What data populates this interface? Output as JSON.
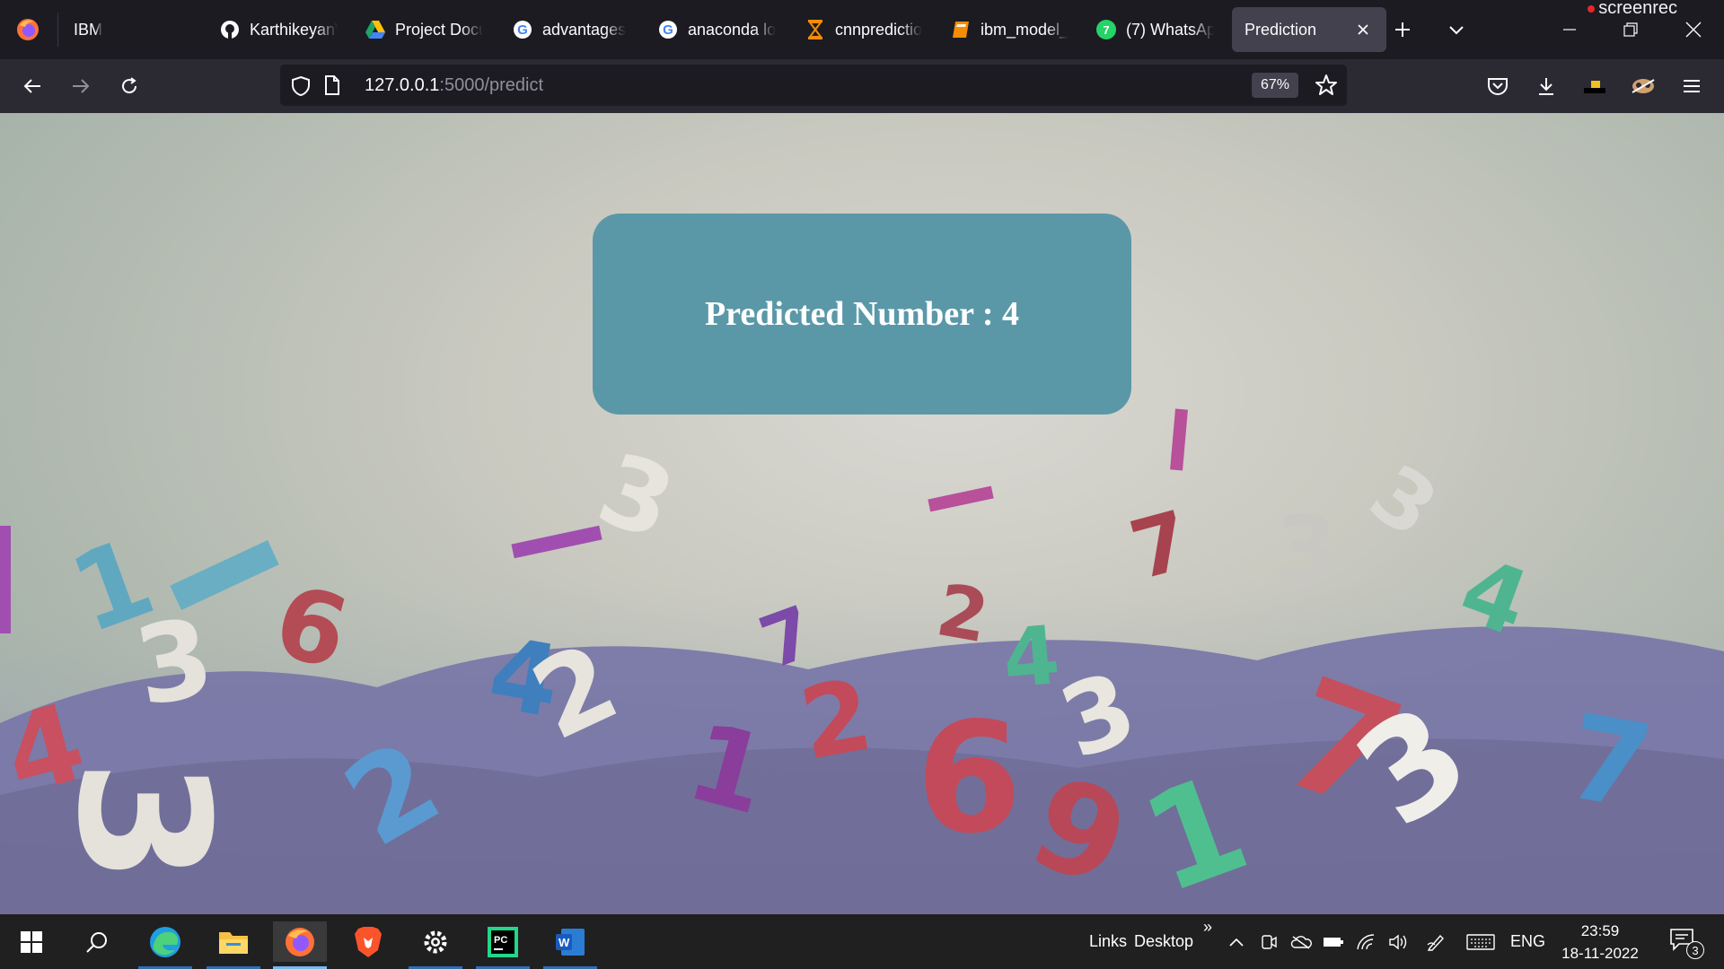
{
  "browser": {
    "tabs": [
      {
        "label": "IBM",
        "icon": "pinned-tab",
        "active": false
      },
      {
        "label": "Karthikeyan\\",
        "icon": "github-icon",
        "active": false
      },
      {
        "label": "Project Docu",
        "icon": "google-drive-icon",
        "active": false
      },
      {
        "label": "advantages",
        "icon": "google-icon",
        "active": false
      },
      {
        "label": "anaconda lo",
        "icon": "google-icon",
        "active": false
      },
      {
        "label": "cnnpredictio",
        "icon": "hourglass-icon",
        "active": false
      },
      {
        "label": "ibm_model_",
        "icon": "book-icon",
        "active": false
      },
      {
        "label": "(7) WhatsAp",
        "icon": "whatsapp-icon",
        "active": false
      },
      {
        "label": "Prediction",
        "icon": "",
        "active": true
      }
    ],
    "recorder_label": "screenrec",
    "url": {
      "host": "127.0.0.1",
      "path": ":5000/predict"
    },
    "zoom": "67%"
  },
  "page": {
    "title": "Predicted Number : 4"
  },
  "taskbar": {
    "links_label": "Links",
    "desktop_label": "Desktop",
    "more_label": "»",
    "language": "ENG",
    "time": "23:59",
    "date": "18-11-2022",
    "notification_count": "3",
    "accent_color": "#5a98a8"
  }
}
